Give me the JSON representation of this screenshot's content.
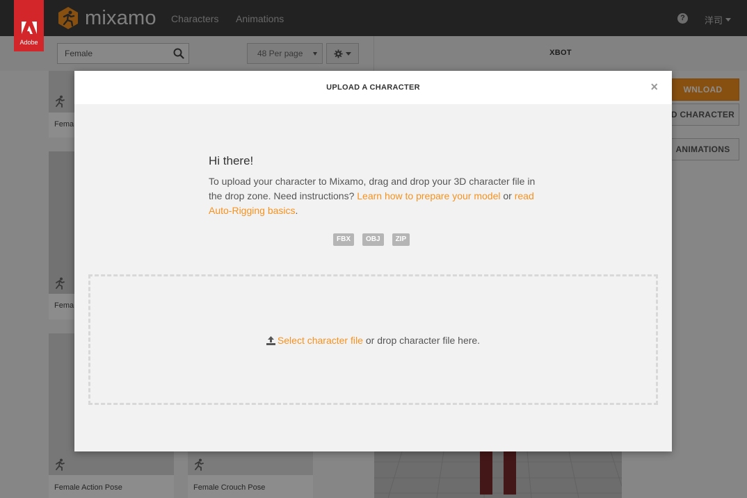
{
  "header": {
    "adobe_label": "Adobe",
    "brand": "mixamo",
    "nav": [
      "Characters",
      "Animations"
    ],
    "help": "?",
    "user": "洋司"
  },
  "toolbar": {
    "search_value": "Female",
    "per_page": "48 Per page"
  },
  "right_panel": {
    "character_name": "XBOT",
    "download_label": "WNLOAD",
    "upload_label": "D CHARACTER",
    "animations_label": "ANIMATIONS"
  },
  "cards": [
    {
      "label": "Fema"
    },
    {
      "label": "Fema"
    },
    {
      "label": "Female Action Pose"
    },
    {
      "label": "Female Crouch Pose"
    }
  ],
  "modal": {
    "title": "UPLOAD A CHARACTER",
    "close": "×",
    "greeting": "Hi there!",
    "intro_text": "To upload your character to Mixamo, drag and drop your 3D character file in the drop zone. Need instructions?",
    "link_prepare": "Learn how to prepare your model",
    "or_text": "or",
    "link_basics": "read Auto-Rigging basics",
    "period": ".",
    "formats": [
      "FBX",
      "OBJ",
      "ZIP"
    ],
    "select_link": "Select character file",
    "drop_suffix": "or drop character file here."
  },
  "colors": {
    "accent": "#f7921e",
    "topbar": "#3f3f3f",
    "adobe_red": "#d3262a"
  }
}
